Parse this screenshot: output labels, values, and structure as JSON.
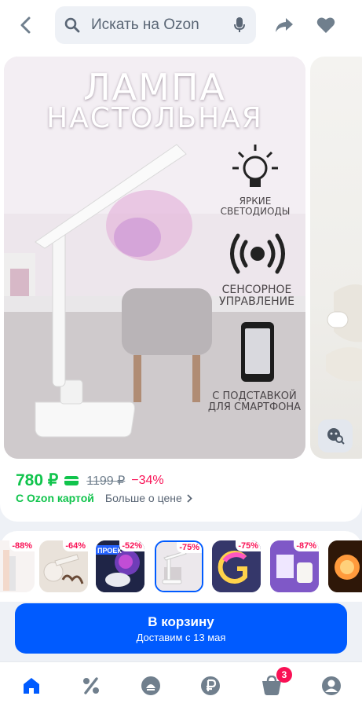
{
  "header": {
    "search_placeholder": "Искать на Ozon"
  },
  "product_image": {
    "title_line1": "ЛАМПА",
    "title_line2": "НАСТОЛЬНАЯ",
    "feature1_line1": "ЯРКИЕ",
    "feature1_line2": "СВЕТОДИОДЫ",
    "feature2_line1": "СЕНСОРНОЕ",
    "feature2_line2": "УПРАВЛЕНИЕ",
    "feature3_line1": "С ПОДСТАВКОЙ",
    "feature3_line2": "ДЛЯ СМАРТФОНА"
  },
  "price": {
    "current": "780 ₽",
    "old": "1199 ₽",
    "discount": "−34%",
    "ozon_card": "С Ozon картой",
    "more": "Больше о цене"
  },
  "variants": [
    {
      "badge": "-88%"
    },
    {
      "badge": "-64%"
    },
    {
      "badge": "-52%",
      "label": "ПРОЕК"
    },
    {
      "badge": "-75%"
    },
    {
      "badge": "-75%"
    },
    {
      "badge": "-87%"
    },
    {
      "badge": ""
    }
  ],
  "cta": {
    "title": "В корзину",
    "subtitle": "Доставим с 13 мая"
  },
  "nav": {
    "cart_count": "3"
  },
  "colors": {
    "accent": "#005bff",
    "price_green": "#10c44c",
    "discount_pink": "#f91155"
  }
}
